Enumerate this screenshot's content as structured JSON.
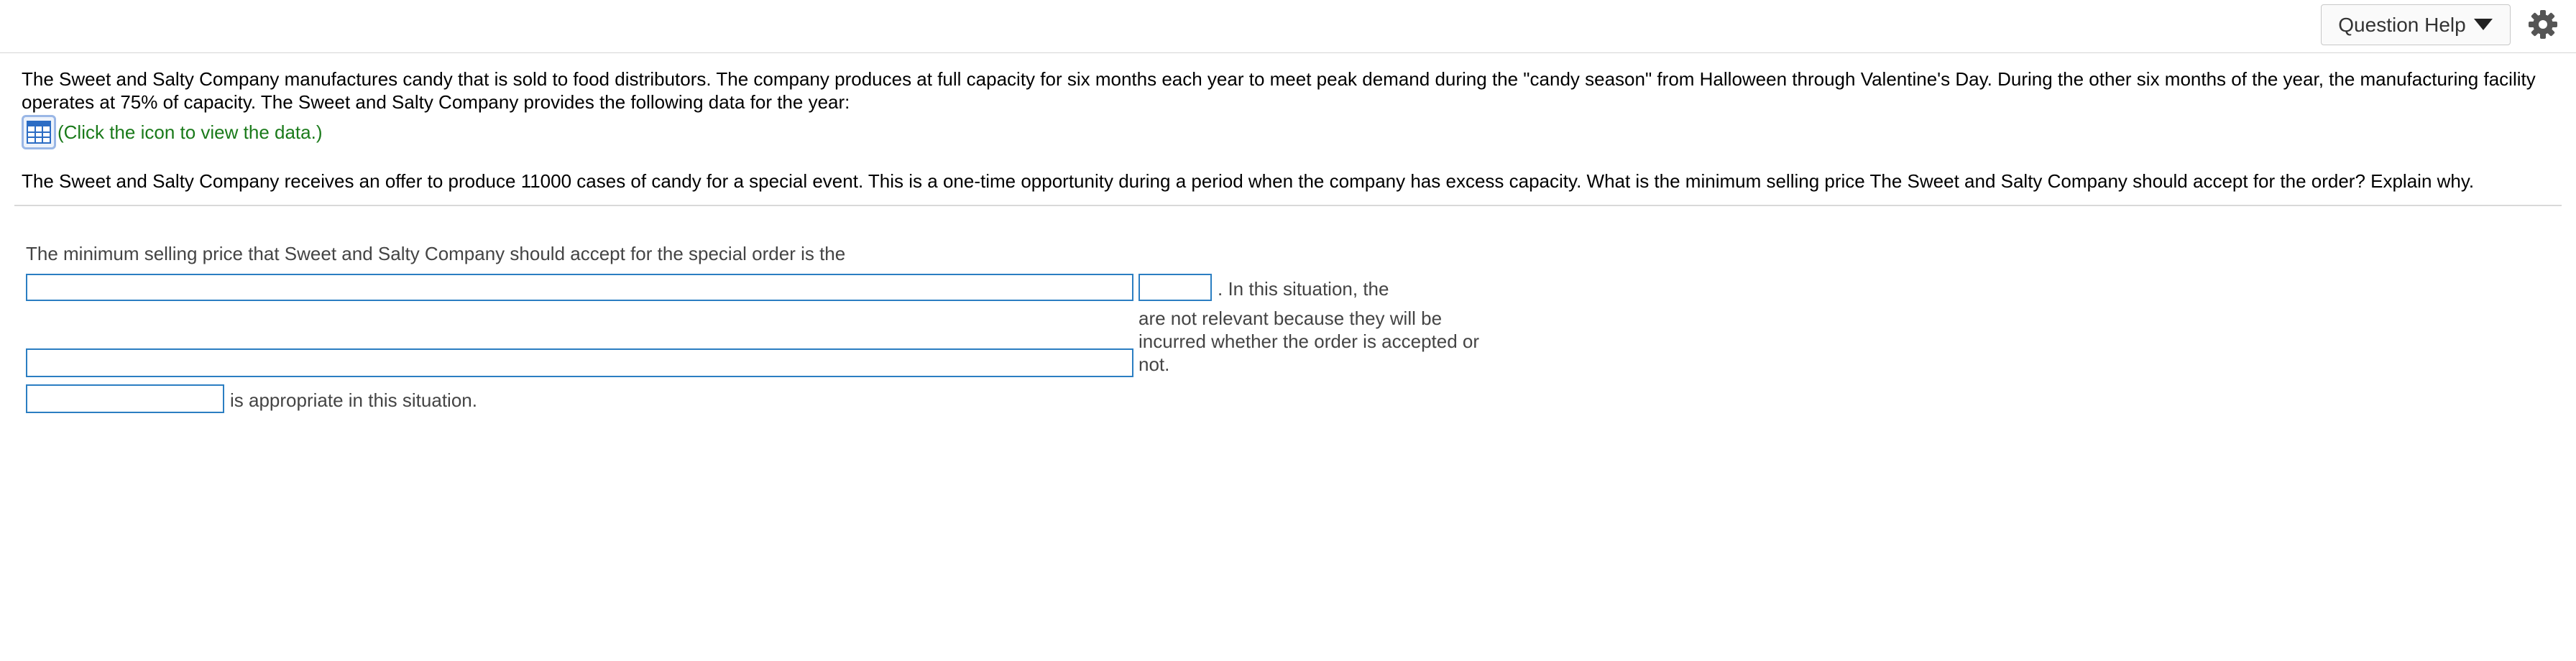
{
  "toolbar": {
    "question_help_label": "Question Help",
    "caret_icon": "caret-down-icon",
    "settings_icon": "gear-icon"
  },
  "question": {
    "intro": "The Sweet and Salty Company manufactures candy that is sold to food distributors. The company produces at full capacity for six months each year to meet peak demand during the \"candy season\" from Halloween through Valentine's Day. During the other six months of the year, the manufacturing facility operates at 75% of capacity. The Sweet and Salty Company provides the following data for the year:",
    "data_link_text": "(Click the icon to view the data.)",
    "data_icon": "table-icon",
    "prompt": "The Sweet and Salty Company receives an offer to produce 11000 cases of candy for a special event. This is a one-time opportunity during a period when the company has excess capacity. What is the minimum selling price The Sweet and Salty Company should accept for the order? Explain why."
  },
  "answer": {
    "lead": "The minimum selling price that Sweet and Salty Company should accept for the special order is the",
    "after_blank2": ". In this situation, the",
    "not_relevant_line1": "are not relevant because they will be",
    "not_relevant_line2": "incurred whether the order is accepted or",
    "not_relevant_line3": "not.",
    "closing": "is appropriate in this situation.",
    "blank1_value": "",
    "blank2_value": "",
    "blank3_value": "",
    "blank4_value": ""
  }
}
